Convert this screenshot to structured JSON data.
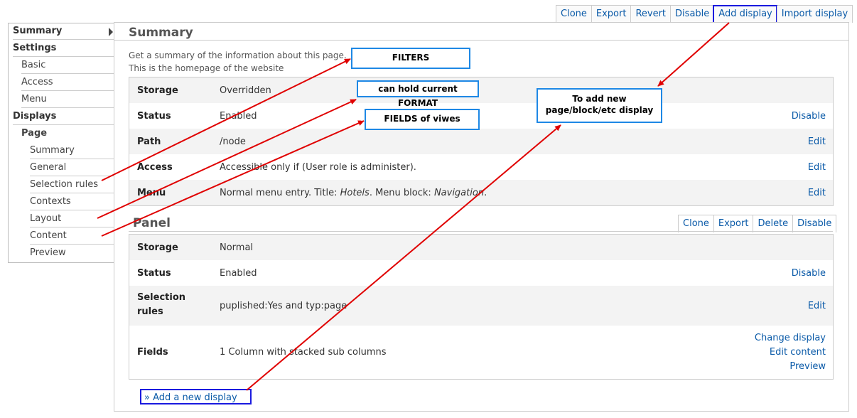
{
  "toolbar": {
    "items": [
      "Clone",
      "Export",
      "Revert",
      "Disable",
      "Add display",
      "Import display"
    ]
  },
  "sidebar": {
    "items": [
      {
        "label": "Summary",
        "level": "head"
      },
      {
        "label": "Settings",
        "level": "head"
      },
      {
        "label": "Basic",
        "level": "sub"
      },
      {
        "label": "Access",
        "level": "sub"
      },
      {
        "label": "Menu",
        "level": "sub"
      },
      {
        "label": "Displays",
        "level": "head"
      },
      {
        "label": "Page",
        "level": "subhead"
      },
      {
        "label": "Summary",
        "level": "sub2"
      },
      {
        "label": "General",
        "level": "sub2"
      },
      {
        "label": "Selection rules",
        "level": "sub2"
      },
      {
        "label": "Contexts",
        "level": "sub2"
      },
      {
        "label": "Layout",
        "level": "sub2"
      },
      {
        "label": "Content",
        "level": "sub2"
      },
      {
        "label": "Preview",
        "level": "sub2"
      }
    ]
  },
  "summary": {
    "title": "Summary",
    "desc1": "Get a summary of the information about this page.",
    "desc2": "This is the homepage of the website",
    "rows": [
      {
        "label": "Storage",
        "value": "Overridden",
        "action": ""
      },
      {
        "label": "Status",
        "value": "Enabled",
        "action": "Disable"
      },
      {
        "label": "Path",
        "value": "/node",
        "action": "Edit"
      },
      {
        "label": "Access",
        "value": "Accessible only if (User role is administer).",
        "action": "Edit"
      },
      {
        "label": "Menu",
        "value_parts": [
          "Normal menu entry. Title: ",
          "Hotels",
          ". Menu block: ",
          "Navigation",
          "."
        ],
        "action": "Edit"
      }
    ]
  },
  "panel": {
    "title": "Panel",
    "toolbar": [
      "Clone",
      "Export",
      "Delete",
      "Disable"
    ],
    "rows": [
      {
        "label": "Storage",
        "value": "Normal"
      },
      {
        "label": "Status",
        "value": "Enabled",
        "action": "Disable"
      },
      {
        "label_line1": "Selection",
        "label_line2": "rules",
        "value": "puplished:Yes and typ:page",
        "action": "Edit"
      },
      {
        "label": "Fields",
        "value": "1 Column with stacked sub columns",
        "actions": [
          "Change display",
          "Edit content",
          "Preview"
        ]
      }
    ]
  },
  "add_new_display": "» Add a new display",
  "callouts": {
    "filters": "FILTERS",
    "format": "can hold current FORMAT",
    "fields": "FIELDS of viwes",
    "add_line1": "To add new",
    "add_line2": "page/block/etc display"
  },
  "colors": {
    "link": "#0a5aa8",
    "arrow": "#e00000",
    "highlight_border": "#1a1adf",
    "callout_border": "#1e88e5"
  }
}
